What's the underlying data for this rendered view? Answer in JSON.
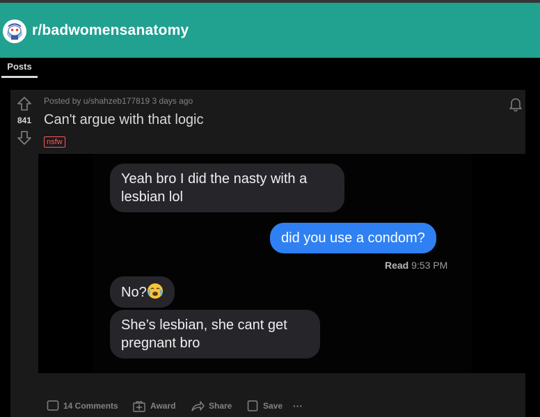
{
  "subreddit": {
    "name": "r/badwomensanatomy"
  },
  "tabs": {
    "posts": "Posts"
  },
  "post": {
    "meta": "Posted by u/shahzeb177819 3 days ago",
    "vote_count": "841",
    "title": "Can't argue with that logic",
    "flair": "nsfw",
    "messages": {
      "m1": "Yeah bro I did the nasty with a lesbian lol",
      "m2": "did you use a condom?",
      "read_label": "Read",
      "read_time": "9:53 PM",
      "m3": "No?",
      "m4": "She’s lesbian, she cant get pregnant bro"
    },
    "actions": {
      "comments": "14 Comments",
      "award": "Award",
      "share": "Share",
      "save": "Save",
      "more": "···"
    }
  },
  "colors": {
    "banner": "#21a190",
    "post_bg": "#1a1a1b",
    "imessage_blue": "#2f80f2",
    "imessage_grey": "#26252a",
    "nsfw": "#ff585b"
  },
  "icons": [
    "snoo-avatar-icon",
    "upvote-icon",
    "downvote-icon",
    "bell-icon",
    "crying-emoji-icon",
    "comment-icon",
    "award-icon",
    "share-icon",
    "save-icon",
    "more-icon"
  ]
}
